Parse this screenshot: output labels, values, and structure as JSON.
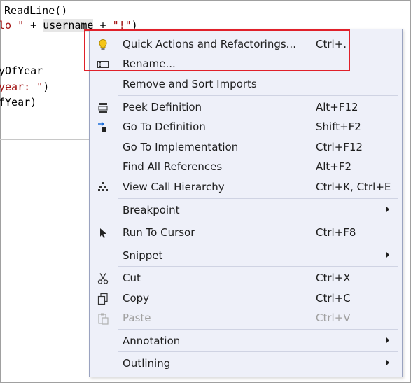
{
  "code": {
    "line1": "ReadLine()",
    "line2": {
      "a": "lo \"",
      "b": " + ",
      "c": "username",
      "d": " + ",
      "e": "\"!\"",
      "f": ")"
    },
    "line3": "yOfYear",
    "line4": {
      "a": "year: \"",
      "b": ")"
    },
    "line5": "fYear)"
  },
  "menu": {
    "items": [
      {
        "label": "Quick Actions and Refactorings...",
        "shortcut": "Ctrl+.",
        "icon": "lightbulb-icon"
      },
      {
        "label": "Rename...",
        "shortcut": "",
        "icon": "rename-icon"
      },
      {
        "label": "Remove and Sort Imports",
        "shortcut": ""
      },
      {
        "label": "Peek Definition",
        "shortcut": "Alt+F12",
        "icon": "peek-definition-icon"
      },
      {
        "label": "Go To Definition",
        "shortcut": "Shift+F2",
        "icon": "go-to-definition-icon"
      },
      {
        "label": "Go To Implementation",
        "shortcut": "Ctrl+F12"
      },
      {
        "label": "Find All References",
        "shortcut": "Alt+F2"
      },
      {
        "label": "View Call Hierarchy",
        "shortcut": "Ctrl+K, Ctrl+E",
        "icon": "call-hierarchy-icon"
      },
      {
        "label": "Breakpoint",
        "submenu": true
      },
      {
        "label": "Run To Cursor",
        "shortcut": "Ctrl+F8",
        "icon": "cursor-icon"
      },
      {
        "label": "Snippet",
        "submenu": true
      },
      {
        "label": "Cut",
        "shortcut": "Ctrl+X",
        "icon": "scissors-icon"
      },
      {
        "label": "Copy",
        "shortcut": "Ctrl+C",
        "icon": "copy-icon"
      },
      {
        "label": "Paste",
        "shortcut": "Ctrl+V",
        "icon": "paste-icon",
        "disabled": true
      },
      {
        "label": "Annotation",
        "submenu": true
      },
      {
        "label": "Outlining",
        "submenu": true
      }
    ]
  },
  "colors": {
    "highlight": "#e0202a",
    "menu_bg": "#eef0f9",
    "string": "#a31515"
  }
}
